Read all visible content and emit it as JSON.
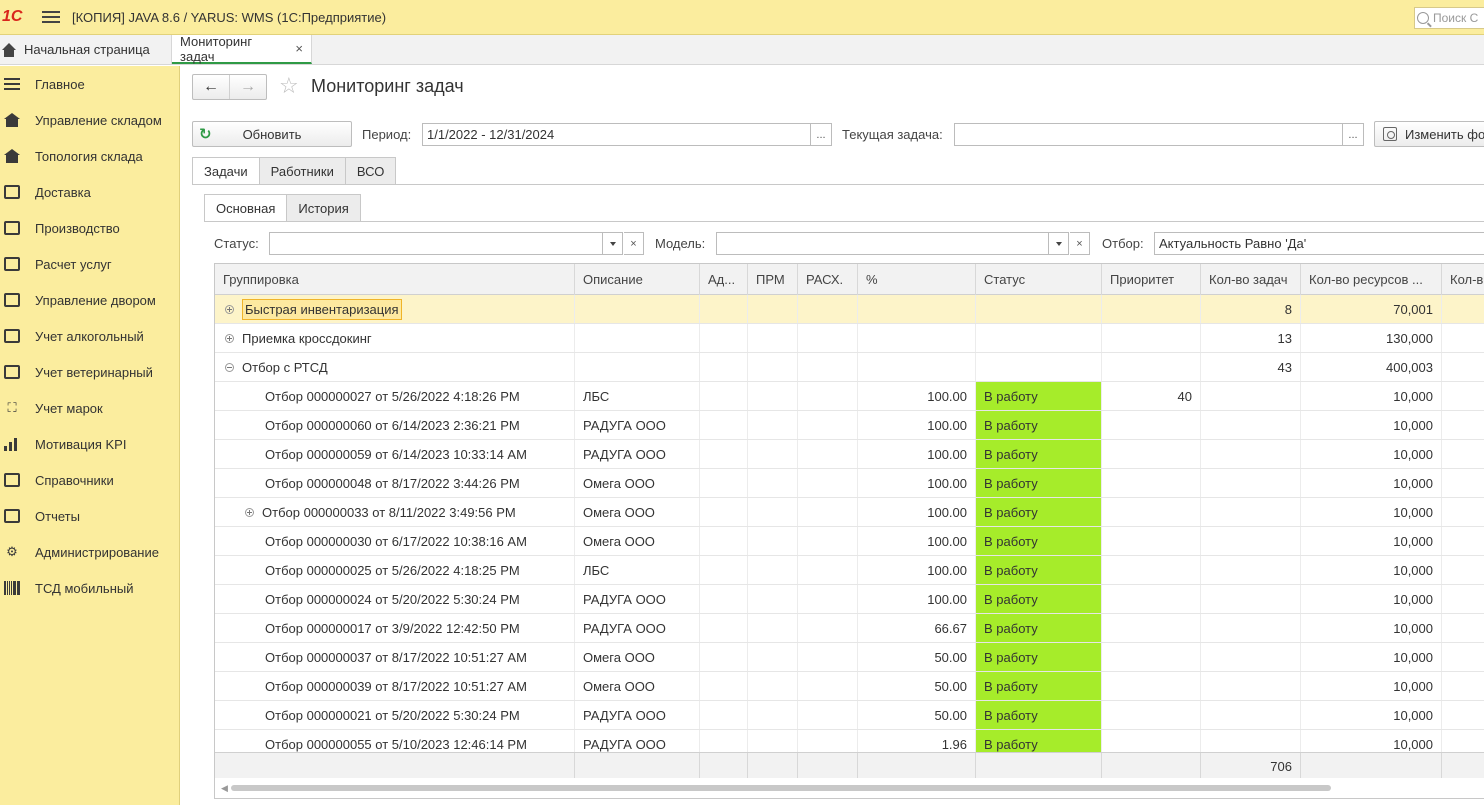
{
  "titlebar": {
    "logo": "1С",
    "title": "[КОПИЯ] JAVA 8.6 / YARUS: WMS   (1С:Предприятие)",
    "search_placeholder": "Поиск С"
  },
  "tabs": {
    "home": "Начальная страница",
    "current": "Мониторинг задач",
    "close": "×"
  },
  "sidebar": {
    "items": [
      {
        "label": "Главное",
        "icon": "menu-lines-icon"
      },
      {
        "label": "Управление складом",
        "icon": "warehouse-icon"
      },
      {
        "label": "Топология склада",
        "icon": "topology-icon"
      },
      {
        "label": "Доставка",
        "icon": "truck-icon"
      },
      {
        "label": "Производство",
        "icon": "factory-icon"
      },
      {
        "label": "Расчет услуг",
        "icon": "calculator-icon"
      },
      {
        "label": "Управление двором",
        "icon": "yard-icon"
      },
      {
        "label": "Учет алкогольный",
        "icon": "bottles-icon"
      },
      {
        "label": "Учет ветеринарный",
        "icon": "vet-icon"
      },
      {
        "label": "Учет марок",
        "icon": "scan-icon"
      },
      {
        "label": "Мотивация KPI",
        "icon": "chart-bars-icon"
      },
      {
        "label": "Справочники",
        "icon": "book-icon"
      },
      {
        "label": "Отчеты",
        "icon": "report-icon"
      },
      {
        "label": "Администрирование",
        "icon": "gear-icon"
      },
      {
        "label": "ТСД мобильный",
        "icon": "barcode-icon"
      }
    ]
  },
  "page": {
    "title": "Мониторинг задач",
    "refresh_label": "Обновить",
    "period_label": "Период:",
    "period_value": "1/1/2022 - 12/31/2024",
    "current_task_label": "Текущая задача:",
    "current_task_value": "",
    "change_form_label": "Изменить фо",
    "ellipsis": "...",
    "tabs": [
      "Задачи",
      "Работники",
      "ВСО"
    ],
    "subtabs": [
      "Основная",
      "История"
    ],
    "status_label": "Статус:",
    "status_value": "",
    "model_label": "Модель:",
    "model_value": "",
    "filter_label": "Отбор:",
    "filter_value": "Актуальность Равно 'Да'",
    "clear": "×"
  },
  "table": {
    "columns": [
      "Группировка",
      "Описание",
      "Ад...",
      "ПРМ",
      "РАСХ.",
      "%",
      "Статус",
      "Приоритет",
      "Кол-во задач",
      "Кол-во ресурсов ...",
      "Кол-в"
    ],
    "groups": [
      {
        "name": "Быстрая инвентаризация",
        "tasks": "8",
        "resources": "70,001",
        "expanded": false
      },
      {
        "name": "Приемка кроссдокинг",
        "tasks": "13",
        "resources": "130,000",
        "expanded": false
      },
      {
        "name": "Отбор с РТСД",
        "tasks": "43",
        "resources": "400,003",
        "expanded": true
      }
    ],
    "rows": [
      {
        "name": "Отбор 000000027 от 5/26/2022 4:18:26 PM",
        "desc": "ЛБС",
        "pct": "100.00",
        "status": "В работу",
        "priority": "40",
        "resources": "10,000"
      },
      {
        "name": "Отбор 000000060 от 6/14/2023 2:36:21 PM",
        "desc": "РАДУГА ООО",
        "pct": "100.00",
        "status": "В работу",
        "priority": "",
        "resources": "10,000"
      },
      {
        "name": "Отбор 000000059 от 6/14/2023 10:33:14 AM",
        "desc": "РАДУГА ООО",
        "pct": "100.00",
        "status": "В работу",
        "priority": "",
        "resources": "10,000"
      },
      {
        "name": "Отбор 000000048 от 8/17/2022 3:44:26 PM",
        "desc": "Омега ООО",
        "pct": "100.00",
        "status": "В работу",
        "priority": "",
        "resources": "10,000"
      },
      {
        "name": "Отбор 000000033 от 8/11/2022 3:49:56 PM",
        "desc": "Омега ООО",
        "pct": "100.00",
        "status": "В работу",
        "priority": "",
        "resources": "10,000",
        "expandable": true
      },
      {
        "name": "Отбор 000000030 от 6/17/2022 10:38:16 AM",
        "desc": "Омега ООО",
        "pct": "100.00",
        "status": "В работу",
        "priority": "",
        "resources": "10,000"
      },
      {
        "name": "Отбор 000000025 от 5/26/2022 4:18:25 PM",
        "desc": "ЛБС",
        "pct": "100.00",
        "status": "В работу",
        "priority": "",
        "resources": "10,000"
      },
      {
        "name": "Отбор 000000024 от 5/20/2022 5:30:24 PM",
        "desc": "РАДУГА ООО",
        "pct": "100.00",
        "status": "В работу",
        "priority": "",
        "resources": "10,000"
      },
      {
        "name": "Отбор 000000017 от 3/9/2022 12:42:50 PM",
        "desc": "РАДУГА ООО",
        "pct": "66.67",
        "status": "В работу",
        "priority": "",
        "resources": "10,000"
      },
      {
        "name": "Отбор 000000037 от 8/17/2022 10:51:27 AM",
        "desc": "Омега ООО",
        "pct": "50.00",
        "status": "В работу",
        "priority": "",
        "resources": "10,000"
      },
      {
        "name": "Отбор 000000039 от 8/17/2022 10:51:27 AM",
        "desc": "Омега ООО",
        "pct": "50.00",
        "status": "В работу",
        "priority": "",
        "resources": "10,000"
      },
      {
        "name": "Отбор 000000021 от 5/20/2022 5:30:24 PM",
        "desc": "РАДУГА ООО",
        "pct": "50.00",
        "status": "В работу",
        "priority": "",
        "resources": "10,000"
      },
      {
        "name": "Отбор 000000055 от 5/10/2023 12:46:14 PM",
        "desc": "РАДУГА ООО",
        "pct": "1.96",
        "status": "В работу",
        "priority": "",
        "resources": "10,000"
      }
    ],
    "footer_tasks_total": "706",
    "status_color": "#a6ec2a"
  }
}
